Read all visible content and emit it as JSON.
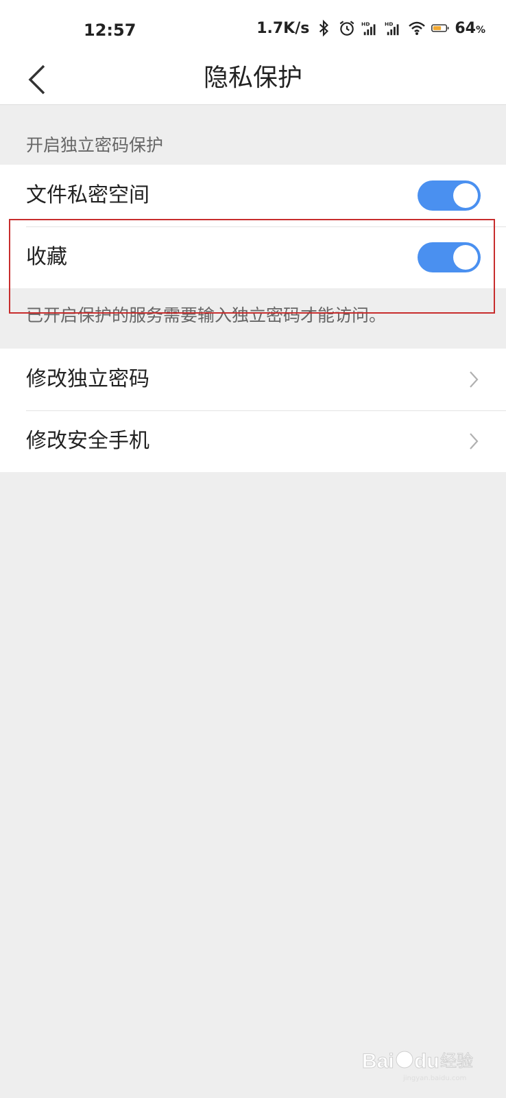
{
  "status_bar": {
    "time": "12:57",
    "net_speed": "1.7K/s",
    "battery_value": "64",
    "battery_unit": "%",
    "battery_color": "#f0a830",
    "icons": [
      "bluetooth-icon",
      "alarm-icon",
      "signal-hd-icon",
      "signal-hd-icon",
      "wifi-icon",
      "battery-icon"
    ]
  },
  "header": {
    "back_icon": "chevron-left-icon",
    "title": "隐私保护"
  },
  "protection": {
    "section_label": "开启独立密码保护",
    "items": [
      {
        "label": "文件私密空间",
        "enabled": true
      },
      {
        "label": "收藏",
        "enabled": true
      }
    ],
    "hint": "已开启保护的服务需要输入独立密码才能访问。"
  },
  "settings": {
    "items": [
      {
        "label": "修改独立密码",
        "icon": "chevron-right-icon"
      },
      {
        "label": "修改安全手机",
        "icon": "chevron-right-icon"
      }
    ]
  },
  "colors": {
    "accent": "#4a90f0",
    "highlight_border": "#c72c2c"
  },
  "watermark": {
    "brand": "Baidu",
    "text": "经验",
    "url": "jingyan.baidu.com"
  }
}
